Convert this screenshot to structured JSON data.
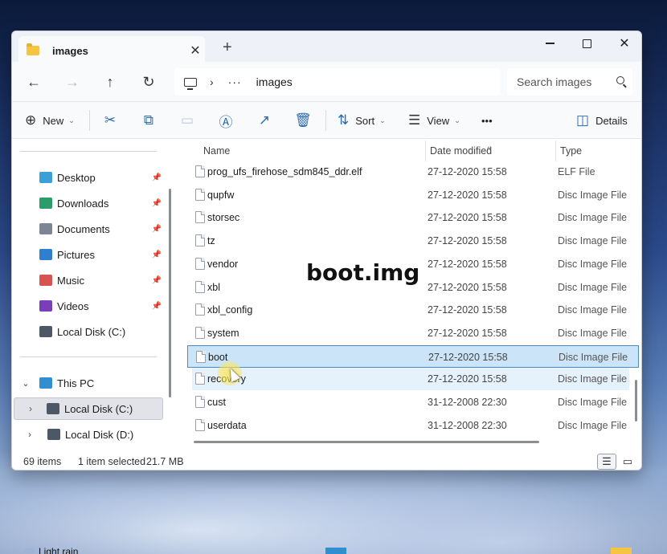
{
  "window": {
    "tab_title": "images",
    "tab_close": "✕",
    "new_tab": "+",
    "minimize": "minimize",
    "maximize": "maximize",
    "close": "✕"
  },
  "nav": {
    "back": "←",
    "forward": "→",
    "up": "↑",
    "refresh": "↻",
    "breadcrumb_sep": "›",
    "breadcrumb_more": "···",
    "breadcrumb_current": "images",
    "search_placeholder": "Search images"
  },
  "toolbar": {
    "new_label": "New",
    "sort_label": "Sort",
    "view_label": "View",
    "more": "•••",
    "details_label": "Details"
  },
  "sidebar": {
    "quick_access": [
      {
        "label": "Desktop",
        "icon": "desktop-icon",
        "color": "#3aa0d8",
        "pinned": true
      },
      {
        "label": "Downloads",
        "icon": "download-icon",
        "color": "#2a9d6a",
        "pinned": true
      },
      {
        "label": "Documents",
        "icon": "document-icon",
        "color": "#7b8595",
        "pinned": true
      },
      {
        "label": "Pictures",
        "icon": "pictures-icon",
        "color": "#2f7fd0",
        "pinned": true
      },
      {
        "label": "Music",
        "icon": "music-icon",
        "color": "#d9534f",
        "pinned": true
      },
      {
        "label": "Videos",
        "icon": "videos-icon",
        "color": "#7a3fb8",
        "pinned": true
      },
      {
        "label": "Local Disk (C:)",
        "icon": "disk-icon",
        "color": "#4d5866",
        "pinned": false
      }
    ],
    "this_pc": {
      "label": "This PC",
      "icon": "pc-icon",
      "color": "#2f8fd0"
    },
    "drives": [
      {
        "label": "Local Disk (C:)",
        "icon": "disk-icon",
        "color": "#4d5866"
      },
      {
        "label": "Local Disk (D:)",
        "icon": "disk-icon",
        "color": "#4d5866"
      }
    ],
    "pin_glyph": "📌",
    "expand_open": "⌄",
    "expand_closed": "›"
  },
  "columns": {
    "name": "Name",
    "date": "Date modified",
    "type": "Type",
    "sort_indicator": "^"
  },
  "files": [
    {
      "name": "prog_ufs_firehose_sdm845_ddr.elf",
      "date": "27-12-2020 15:58",
      "type": "ELF File",
      "state": "normal"
    },
    {
      "name": "qupfw",
      "date": "27-12-2020 15:58",
      "type": "Disc Image File",
      "state": "normal"
    },
    {
      "name": "storsec",
      "date": "27-12-2020 15:58",
      "type": "Disc Image File",
      "state": "normal"
    },
    {
      "name": "tz",
      "date": "27-12-2020 15:58",
      "type": "Disc Image File",
      "state": "normal"
    },
    {
      "name": "vendor",
      "date": "27-12-2020 15:58",
      "type": "Disc Image File",
      "state": "normal"
    },
    {
      "name": "xbl",
      "date": "27-12-2020 15:58",
      "type": "Disc Image File",
      "state": "normal"
    },
    {
      "name": "xbl_config",
      "date": "27-12-2020 15:58",
      "type": "Disc Image File",
      "state": "normal"
    },
    {
      "name": "system",
      "date": "27-12-2020 15:58",
      "type": "Disc Image File",
      "state": "normal"
    },
    {
      "name": "boot",
      "date": "27-12-2020 15:58",
      "type": "Disc Image File",
      "state": "selected"
    },
    {
      "name": "recovery",
      "date": "27-12-2020 15:58",
      "type": "Disc Image File",
      "state": "hover"
    },
    {
      "name": "cust",
      "date": "31-12-2008 22:30",
      "type": "Disc Image File",
      "state": "normal"
    },
    {
      "name": "userdata",
      "date": "31-12-2008 22:30",
      "type": "Disc Image File",
      "state": "normal"
    }
  ],
  "overlay_text": "boot.img",
  "status": {
    "item_count": "69 items",
    "selection": "1 item selected",
    "size": "21.7 MB"
  },
  "taskbar": {
    "weather": "Light rain"
  }
}
